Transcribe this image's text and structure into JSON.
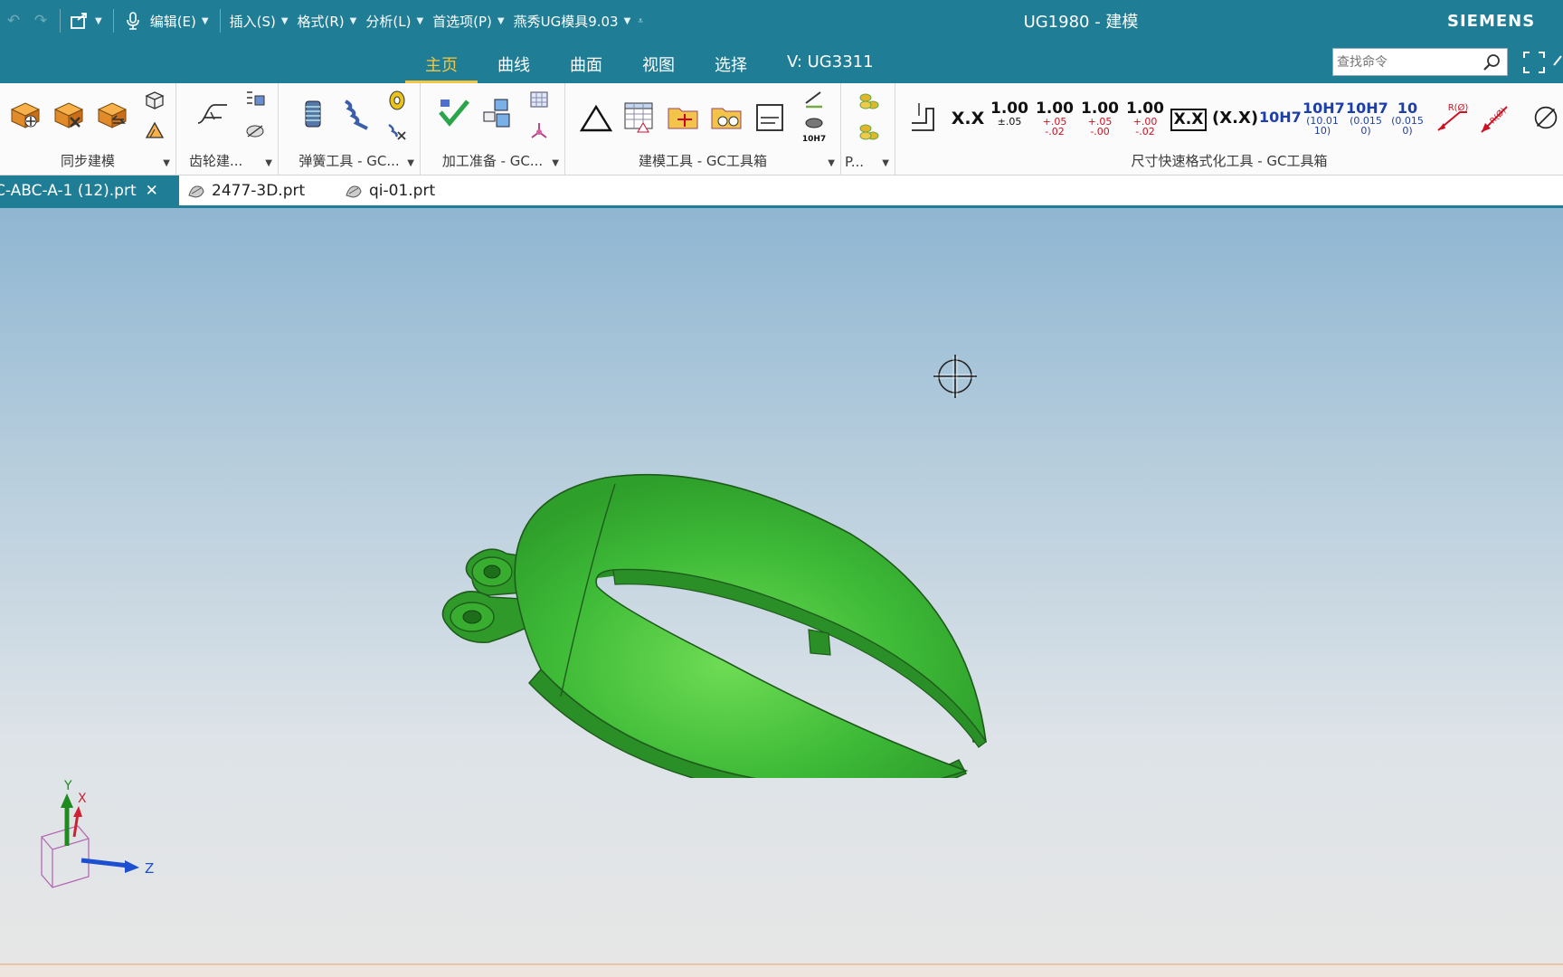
{
  "titlebar": {
    "title": "UG1980 - 建模",
    "brand": "SIEMENS",
    "menus": [
      {
        "label": "编辑(E)"
      },
      {
        "label": "插入(S)"
      },
      {
        "label": "格式(R)"
      },
      {
        "label": "分析(L)"
      },
      {
        "label": "首选项(P)"
      },
      {
        "label": "燕秀UG模具9.03"
      }
    ]
  },
  "tabs": [
    {
      "label": "主页",
      "active": true
    },
    {
      "label": "曲线",
      "active": false
    },
    {
      "label": "曲面",
      "active": false
    },
    {
      "label": "视图",
      "active": false
    },
    {
      "label": "选择",
      "active": false
    },
    {
      "label": "V:  UG3311",
      "active": false
    }
  ],
  "search": {
    "placeholder": "查找命令"
  },
  "ribbon": {
    "groups": [
      {
        "label": "同步建模"
      },
      {
        "label": "齿轮建..."
      },
      {
        "label": "弹簧工具 - GC..."
      },
      {
        "label": "加工准备 - GC..."
      },
      {
        "label": "建模工具 - GC工具箱"
      },
      {
        "label": "P..."
      },
      {
        "label": "尺寸快速格式化工具 - GC工具箱"
      }
    ],
    "dim_buttons": {
      "xx": "X.X",
      "v1_main": "1.00",
      "v1_sub": "±.05",
      "v2_main": "1.00",
      "v2_sub": "+.05 -.02",
      "v3_main": "1.00",
      "v3_sub": "+.05 -.00",
      "v4_main": "1.00",
      "v4_sub": "+.00 -.02",
      "boxed": "X.X",
      "paren": "(X.X)",
      "fit": "10H7",
      "fit2_main": "10H7",
      "fit2_sub": "(10.01 10)",
      "fit3_main": "10H7",
      "fit3_sub": "(0.015 0)",
      "fit4_main": "10",
      "fit4_sub": "(0.015 0)",
      "r1": "R(Ø)",
      "r2": "R(Ø)"
    },
    "small_fit_label": "10H7"
  },
  "file_tabs": [
    {
      "label": "C-ABC-A-1 (12).prt",
      "active": true
    },
    {
      "label": "2477-3D.prt",
      "active": false
    },
    {
      "label": "qi-01.prt",
      "active": false
    }
  ],
  "colors": {
    "titlebar": "#1f7e96",
    "active_tab": "#f5c542",
    "part_green": "#3cb83c"
  },
  "triad": {
    "y": "Y",
    "x": "X",
    "z": "Z"
  }
}
